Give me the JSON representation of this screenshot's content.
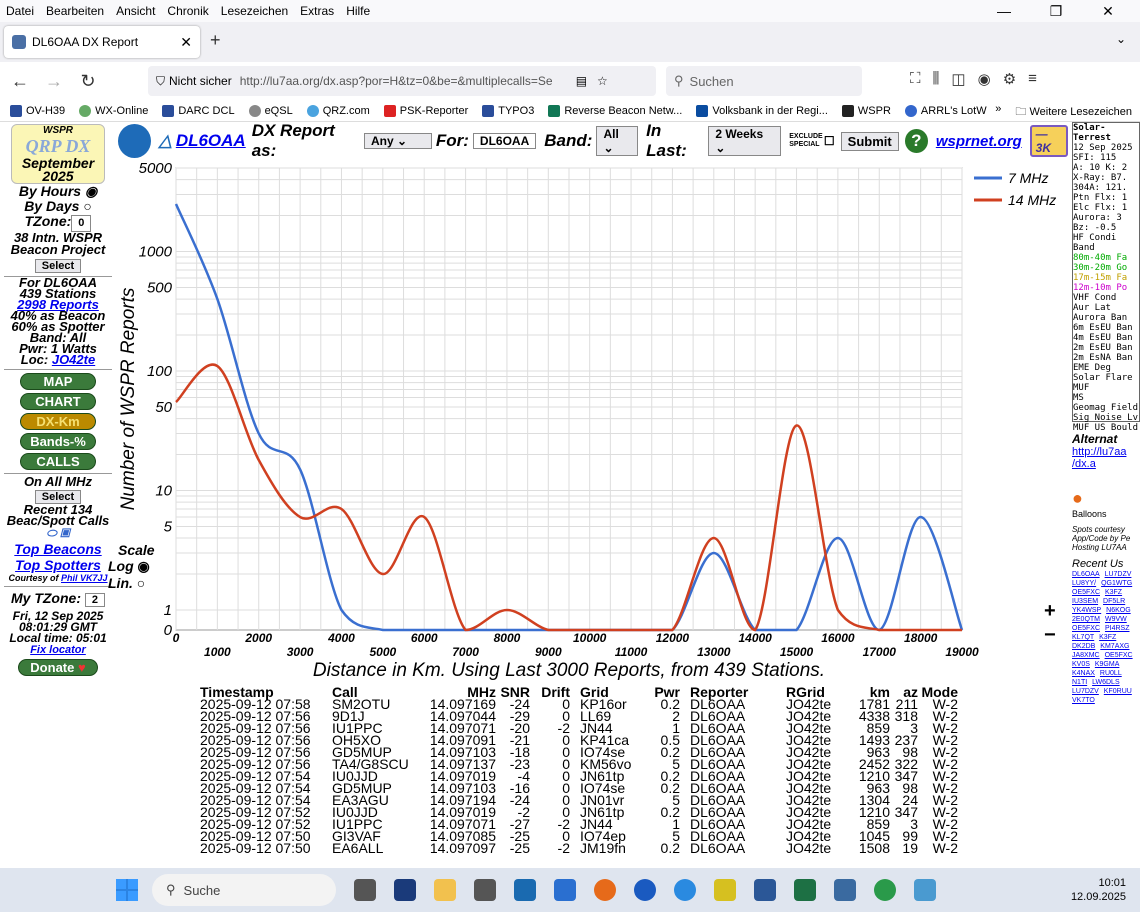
{
  "browser": {
    "menu": [
      "Datei",
      "Bearbeiten",
      "Ansicht",
      "Chronik",
      "Lesezeichen",
      "Extras",
      "Hilfe"
    ],
    "tab_title": "DL6OAA DX Report",
    "not_secure": "Nicht sicher",
    "url": "http://lu7aa.org/dx.asp?por=H&tz=0&be=&multiplecalls=Se",
    "search_placeholder": "Suchen",
    "bookmarks": [
      "OV-H39",
      "WX-Online",
      "DARC DCL",
      "eQSL",
      "QRZ.com",
      "PSK-Reporter",
      "TYPO3",
      "Reverse Beacon Netw...",
      "Volksbank in der Regi...",
      "WSPR",
      "ARRL's LotW"
    ],
    "bookmarks_more": "Weitere Lesezeichen"
  },
  "left": {
    "wspr": "WSPR",
    "qrpdx": "QRP DX",
    "month": "September",
    "year": "2025",
    "by_hours": "By Hours",
    "by_days": "By Days",
    "tzone_label": "TZone:",
    "tzone_value": "0",
    "project": "38 Intn. WSPR Beacon Project",
    "select": "Select",
    "for_call": "For DL6OAA",
    "stations": "439 Stations",
    "reports": "2998 Reports",
    "beacon_pct": "40% as Beacon",
    "spotter_pct": "60% as Spotter",
    "band": "Band: All",
    "pwr": "Pwr: 1 Watts",
    "loc_label": "Loc:",
    "loc": "JO42te",
    "buttons": [
      "MAP",
      "CHART",
      "DX-Km",
      "Bands-%",
      "CALLS"
    ],
    "on_all": "On All MHz",
    "recent": "Recent 134 Beac/Spott Calls",
    "top_beacons": "Top Beacons",
    "top_spotters": "Top Spotters",
    "courtesy": "Courtesy of",
    "courtesy_name": "Phil VK7JJ",
    "my_tzone": "My TZone:",
    "my_tzone_val": "2",
    "date": "Fri, 12 Sep 2025",
    "gmt": "08:01:29 GMT",
    "local": "Local time: 05:01",
    "fix": "Fix locator",
    "donate": "Donate"
  },
  "header": {
    "call": "DL6OAA",
    "dx_report": "DX Report as:",
    "as_value": "Any",
    "for_label": "For:",
    "for_value": "DL6OAA",
    "band_label": "Band:",
    "band_value": "All",
    "inlast_label": "In Last:",
    "inlast_value": "2 Weeks",
    "exclude": "EXCLUDE SPECIAL",
    "submit": "Submit",
    "wsprnet": "wsprnet.org",
    "k3": "—3K"
  },
  "scale": {
    "label": "Scale",
    "log": "Log",
    "lin": "Lin."
  },
  "chart_data": {
    "type": "line",
    "xlabel": "Distance in Km. Using Last 3000 Reports, from 439 Stations.",
    "ylabel": "Number of WSPR Reports",
    "y_scale": "log",
    "y_ticks": [
      "0",
      "1",
      "5",
      "10",
      "50",
      "100",
      "500",
      "1000",
      "5000"
    ],
    "x_ticks_top": [
      "0",
      "2000",
      "4000",
      "6000",
      "8000",
      "10000",
      "12000",
      "14000",
      "16000",
      "18000"
    ],
    "x_ticks_bottom": [
      "1000",
      "3000",
      "5000",
      "7000",
      "9000",
      "11000",
      "13000",
      "15000",
      "17000",
      "19000"
    ],
    "x": [
      0,
      1000,
      2000,
      3000,
      4000,
      5000,
      6000,
      7000,
      8000,
      9000,
      10000,
      11000,
      12000,
      13000,
      14000,
      15000,
      16000,
      17000,
      18000,
      19000
    ],
    "series": [
      {
        "name": "7 MHz",
        "color": "#3a6fd0",
        "values": [
          2500,
          400,
          30,
          15,
          1,
          0,
          0,
          0,
          0,
          0,
          0,
          0,
          0,
          3,
          0,
          0,
          4,
          0,
          6,
          0
        ]
      },
      {
        "name": "14 MHz",
        "color": "#d04020",
        "values": [
          55,
          110,
          18,
          6,
          7,
          2,
          6,
          0,
          1,
          0,
          0,
          0,
          0,
          4,
          0,
          35,
          1,
          0,
          0,
          0
        ]
      }
    ]
  },
  "table": {
    "headers": [
      "Timestamp",
      "Call",
      "MHz",
      "SNR",
      "Drift",
      "Grid",
      "Pwr",
      "Reporter",
      "RGrid",
      "km",
      "az",
      "Mode"
    ],
    "rows": [
      [
        "2025-09-12 07:58",
        "SM2OTU",
        "14.097169",
        "-24",
        "0",
        "KP16or",
        "0.2",
        "DL6OAA",
        "JO42te",
        "1781",
        "211",
        "W-2"
      ],
      [
        "2025-09-12 07:56",
        "9D1J",
        "14.097044",
        "-29",
        "0",
        "LL69",
        "2",
        "DL6OAA",
        "JO42te",
        "4338",
        "318",
        "W-2"
      ],
      [
        "2025-09-12 07:56",
        "IU1PPC",
        "14.097071",
        "-20",
        "-2",
        "JN44",
        "1",
        "DL6OAA",
        "JO42te",
        "859",
        "3",
        "W-2"
      ],
      [
        "2025-09-12 07:56",
        "OH5XO",
        "14.097091",
        "-21",
        "0",
        "KP41ca",
        "0.5",
        "DL6OAA",
        "JO42te",
        "1493",
        "237",
        "W-2"
      ],
      [
        "2025-09-12 07:56",
        "GD5MUP",
        "14.097103",
        "-18",
        "0",
        "IO74se",
        "0.2",
        "DL6OAA",
        "JO42te",
        "963",
        "98",
        "W-2"
      ],
      [
        "2025-09-12 07:56",
        "TA4/G8SCU",
        "14.097137",
        "-23",
        "0",
        "KM56vo",
        "5",
        "DL6OAA",
        "JO42te",
        "2452",
        "322",
        "W-2"
      ],
      [
        "2025-09-12 07:54",
        "IU0JJD",
        "14.097019",
        "-4",
        "0",
        "JN61tp",
        "0.2",
        "DL6OAA",
        "JO42te",
        "1210",
        "347",
        "W-2"
      ],
      [
        "2025-09-12 07:54",
        "GD5MUP",
        "14.097103",
        "-16",
        "0",
        "IO74se",
        "0.2",
        "DL6OAA",
        "JO42te",
        "963",
        "98",
        "W-2"
      ],
      [
        "2025-09-12 07:54",
        "EA3AGU",
        "14.097194",
        "-24",
        "0",
        "JN01vr",
        "5",
        "DL6OAA",
        "JO42te",
        "1304",
        "24",
        "W-2"
      ],
      [
        "2025-09-12 07:52",
        "IU0JJD",
        "14.097019",
        "-2",
        "0",
        "JN61tp",
        "0.2",
        "DL6OAA",
        "JO42te",
        "1210",
        "347",
        "W-2"
      ],
      [
        "2025-09-12 07:52",
        "IU1PPC",
        "14.097071",
        "-27",
        "-2",
        "JN44",
        "1",
        "DL6OAA",
        "JO42te",
        "859",
        "3",
        "W-2"
      ],
      [
        "2025-09-12 07:50",
        "GI3VAF",
        "14.097085",
        "-25",
        "0",
        "IO74ep",
        "5",
        "DL6OAA",
        "JO42te",
        "1045",
        "99",
        "W-2"
      ],
      [
        "2025-09-12 07:50",
        "EA6ALL",
        "14.097097",
        "-25",
        "-2",
        "JM19fn",
        "0.2",
        "DL6OAA",
        "JO42te",
        "1508",
        "19",
        "W-2"
      ]
    ]
  },
  "right": {
    "title": "Solar-Terrest",
    "lines": [
      "12 Sep 2025",
      "SFI: 115",
      "A: 10 K: 2",
      "X-Ray: B7.",
      "304A: 121.",
      "Ptn Flx: 1",
      "Elc Flx: 1",
      "Aurora: 3",
      "Bz: -0.5",
      "HF Condi",
      "Band",
      "80m-40m Fa",
      "30m-20m Go",
      "17m-15m Fa",
      "12m-10m Po",
      "VHF Cond",
      "Aur Lat",
      "Aurora Ban",
      "6m EsEU Ban",
      "4m EsEU Ban",
      "2m EsEU Ban",
      "2m EsNA Ban",
      "EME Deg",
      "Solar Flare",
      "MUF",
      "MS",
      "Geomag Field",
      "Sig Noise Lv",
      "MUF US Bould"
    ],
    "alternate": "Alternat",
    "alt_link": "http://lu7aa /dx.a",
    "balloons": "Balloons",
    "spots": "Spots courtesy App/Code by Pe Hosting LU7AA",
    "recent": "Recent Us",
    "calls": [
      "DL6OAA",
      "LU7DZV",
      "LU8YY/",
      "QG1WTG",
      "OE5FXC",
      "K3FZ",
      "IU3SEM",
      "DF5LR",
      "YK4WSP",
      "N6KOG",
      "2E0QTM",
      "W9VW",
      "OE5FXC",
      "PI4RSZ",
      "KL7QT",
      "K3FZ",
      "DK2DB",
      "KM7AXG",
      "JA8XMC",
      "OE5FXC",
      "KV0S",
      "K9GMA",
      "K4NAX",
      "RU0LL",
      "N1TI",
      "LW6DLS",
      "LU7DZV",
      "KF0RUU",
      "VK7TO"
    ]
  },
  "taskbar": {
    "search": "Suche",
    "time": "10:01",
    "date": "12.09.2025"
  }
}
